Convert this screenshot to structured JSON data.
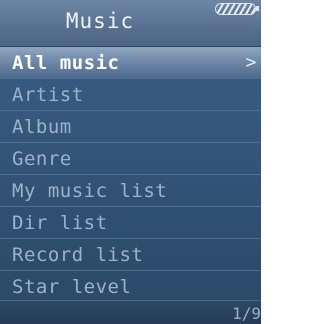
{
  "header": {
    "title": "Music",
    "battery_icon": "battery-icon"
  },
  "menu": {
    "items": [
      {
        "label": "All music",
        "selected": true
      },
      {
        "label": "Artist"
      },
      {
        "label": "Album"
      },
      {
        "label": "Genre"
      },
      {
        "label": "My music list"
      },
      {
        "label": "Dir list"
      },
      {
        "label": "Record list"
      },
      {
        "label": "Star level"
      }
    ],
    "chevron": ">"
  },
  "footer": {
    "page_indicator": "1/9"
  },
  "colors": {
    "background": "#35587c",
    "selected_highlight": "#7a93b0",
    "text": "#9db2c8",
    "selected_text": "#ffffff"
  }
}
